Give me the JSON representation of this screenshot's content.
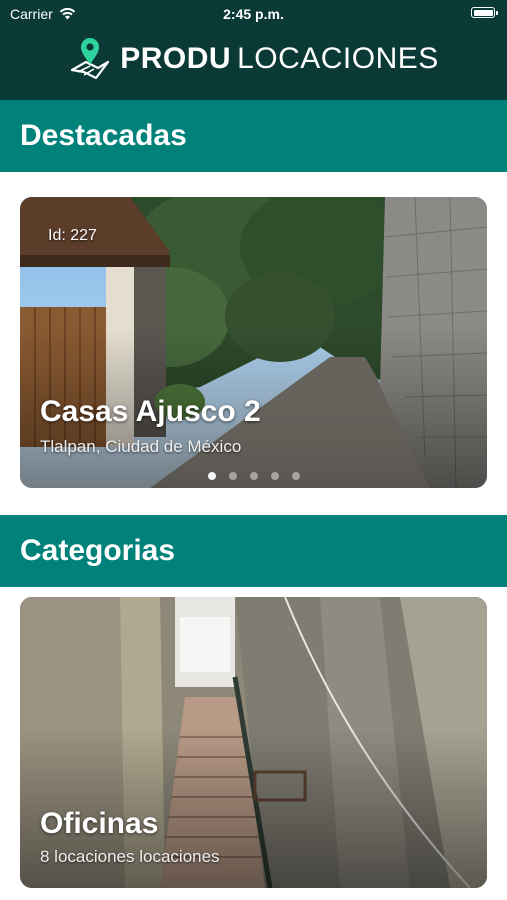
{
  "status_bar": {
    "carrier": "Carrier",
    "time": "2:45 p.m.",
    "battery_level": 1.0
  },
  "header": {
    "logo_icon": "location-pin-map-icon",
    "brand_bold": "PRODU",
    "brand_light": "LOCACIONES"
  },
  "sections": {
    "featured_title": "Destacadas",
    "categories_title": "Categorias"
  },
  "featured_card": {
    "id_label": "Id: 227",
    "title": "Casas Ajusco  2",
    "subtitle": "Tlalpan, Ciudad de México",
    "page_count": 5,
    "active_page": 1
  },
  "category_card": {
    "title": "Oficinas",
    "subtitle": "8 locaciones locaciones"
  },
  "colors": {
    "header_bg": "#0b3936",
    "section_bg": "#00817a",
    "accent_pin": "#2fd39d"
  }
}
